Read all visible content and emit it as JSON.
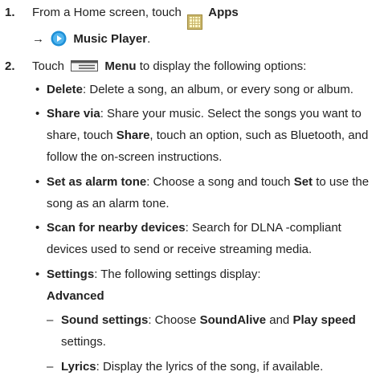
{
  "steps": [
    {
      "number": "1.",
      "line1_text": "From a Home screen, touch",
      "apps_label": "Apps",
      "arrow": "→",
      "music_label": "Music Player",
      "period": ".",
      "icons": [
        "apps-grid-icon",
        "music-player-icon"
      ]
    },
    {
      "number": "2.",
      "text_before": "Touch",
      "menu_label": "Menu",
      "text_after": "to display the following options:",
      "icon": "menu-icon"
    }
  ],
  "options": [
    {
      "label": "Delete",
      "lines": [
        ": Delete a song, an album, or every song or album."
      ]
    },
    {
      "label": "Share via",
      "lines": [
        ": Share your music. Select the songs you want to"
      ],
      "line2_before": "share, touch ",
      "line2_bold": "Share",
      "line2_after": ", touch an option, such as Bluetooth, and",
      "line3": "follow the on-screen instructions."
    },
    {
      "label": "Set as alarm tone",
      "text_before": ": Choose a song and touch ",
      "bold": "Set",
      "text_after": " to use the",
      "line2": "song as an alarm tone."
    },
    {
      "label": "Scan for nearby devices",
      "text": ": Search for DLNA -compliant",
      "line2": "devices used to send or receive streaming media."
    },
    {
      "label": "Settings",
      "text": ": The following settings display:"
    }
  ],
  "advanced": {
    "heading": "Advanced",
    "dash": "–",
    "items": [
      {
        "label": "Sound settings",
        "text_before": ": Choose ",
        "bold1": "SoundAlive",
        "text_mid": " and ",
        "bold2": "Play speed",
        "line2": "settings."
      },
      {
        "label": "Lyrics",
        "text": ": Display the lyrics of the song, if available."
      }
    ]
  },
  "bullet_char": "•",
  "colors": {
    "text": "#222222",
    "apps_icon": "#c9b66a",
    "music_icon": "#1e8fd6"
  }
}
